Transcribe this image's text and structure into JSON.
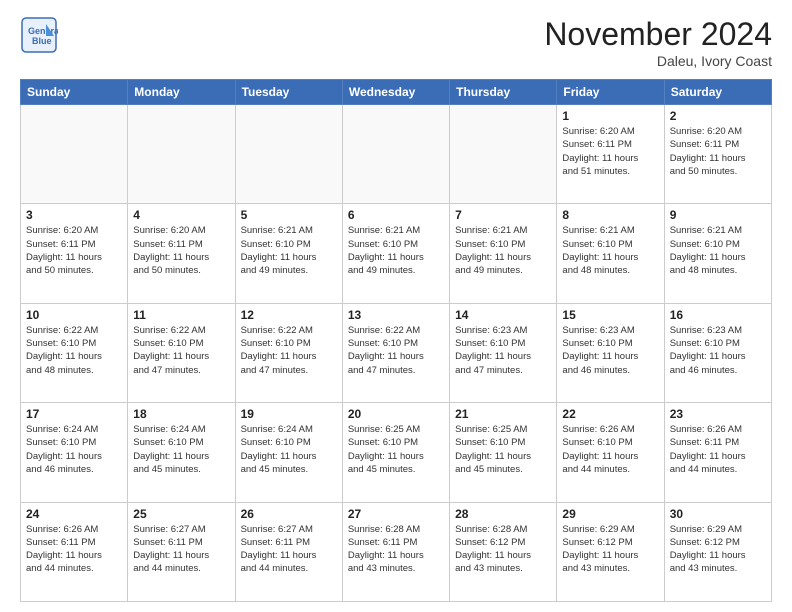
{
  "header": {
    "logo_line1": "General",
    "logo_line2": "Blue",
    "month": "November 2024",
    "location": "Daleu, Ivory Coast"
  },
  "weekdays": [
    "Sunday",
    "Monday",
    "Tuesday",
    "Wednesday",
    "Thursday",
    "Friday",
    "Saturday"
  ],
  "weeks": [
    [
      {
        "day": "",
        "info": ""
      },
      {
        "day": "",
        "info": ""
      },
      {
        "day": "",
        "info": ""
      },
      {
        "day": "",
        "info": ""
      },
      {
        "day": "",
        "info": ""
      },
      {
        "day": "1",
        "info": "Sunrise: 6:20 AM\nSunset: 6:11 PM\nDaylight: 11 hours\nand 51 minutes."
      },
      {
        "day": "2",
        "info": "Sunrise: 6:20 AM\nSunset: 6:11 PM\nDaylight: 11 hours\nand 50 minutes."
      }
    ],
    [
      {
        "day": "3",
        "info": "Sunrise: 6:20 AM\nSunset: 6:11 PM\nDaylight: 11 hours\nand 50 minutes."
      },
      {
        "day": "4",
        "info": "Sunrise: 6:20 AM\nSunset: 6:11 PM\nDaylight: 11 hours\nand 50 minutes."
      },
      {
        "day": "5",
        "info": "Sunrise: 6:21 AM\nSunset: 6:10 PM\nDaylight: 11 hours\nand 49 minutes."
      },
      {
        "day": "6",
        "info": "Sunrise: 6:21 AM\nSunset: 6:10 PM\nDaylight: 11 hours\nand 49 minutes."
      },
      {
        "day": "7",
        "info": "Sunrise: 6:21 AM\nSunset: 6:10 PM\nDaylight: 11 hours\nand 49 minutes."
      },
      {
        "day": "8",
        "info": "Sunrise: 6:21 AM\nSunset: 6:10 PM\nDaylight: 11 hours\nand 48 minutes."
      },
      {
        "day": "9",
        "info": "Sunrise: 6:21 AM\nSunset: 6:10 PM\nDaylight: 11 hours\nand 48 minutes."
      }
    ],
    [
      {
        "day": "10",
        "info": "Sunrise: 6:22 AM\nSunset: 6:10 PM\nDaylight: 11 hours\nand 48 minutes."
      },
      {
        "day": "11",
        "info": "Sunrise: 6:22 AM\nSunset: 6:10 PM\nDaylight: 11 hours\nand 47 minutes."
      },
      {
        "day": "12",
        "info": "Sunrise: 6:22 AM\nSunset: 6:10 PM\nDaylight: 11 hours\nand 47 minutes."
      },
      {
        "day": "13",
        "info": "Sunrise: 6:22 AM\nSunset: 6:10 PM\nDaylight: 11 hours\nand 47 minutes."
      },
      {
        "day": "14",
        "info": "Sunrise: 6:23 AM\nSunset: 6:10 PM\nDaylight: 11 hours\nand 47 minutes."
      },
      {
        "day": "15",
        "info": "Sunrise: 6:23 AM\nSunset: 6:10 PM\nDaylight: 11 hours\nand 46 minutes."
      },
      {
        "day": "16",
        "info": "Sunrise: 6:23 AM\nSunset: 6:10 PM\nDaylight: 11 hours\nand 46 minutes."
      }
    ],
    [
      {
        "day": "17",
        "info": "Sunrise: 6:24 AM\nSunset: 6:10 PM\nDaylight: 11 hours\nand 46 minutes."
      },
      {
        "day": "18",
        "info": "Sunrise: 6:24 AM\nSunset: 6:10 PM\nDaylight: 11 hours\nand 45 minutes."
      },
      {
        "day": "19",
        "info": "Sunrise: 6:24 AM\nSunset: 6:10 PM\nDaylight: 11 hours\nand 45 minutes."
      },
      {
        "day": "20",
        "info": "Sunrise: 6:25 AM\nSunset: 6:10 PM\nDaylight: 11 hours\nand 45 minutes."
      },
      {
        "day": "21",
        "info": "Sunrise: 6:25 AM\nSunset: 6:10 PM\nDaylight: 11 hours\nand 45 minutes."
      },
      {
        "day": "22",
        "info": "Sunrise: 6:26 AM\nSunset: 6:10 PM\nDaylight: 11 hours\nand 44 minutes."
      },
      {
        "day": "23",
        "info": "Sunrise: 6:26 AM\nSunset: 6:11 PM\nDaylight: 11 hours\nand 44 minutes."
      }
    ],
    [
      {
        "day": "24",
        "info": "Sunrise: 6:26 AM\nSunset: 6:11 PM\nDaylight: 11 hours\nand 44 minutes."
      },
      {
        "day": "25",
        "info": "Sunrise: 6:27 AM\nSunset: 6:11 PM\nDaylight: 11 hours\nand 44 minutes."
      },
      {
        "day": "26",
        "info": "Sunrise: 6:27 AM\nSunset: 6:11 PM\nDaylight: 11 hours\nand 44 minutes."
      },
      {
        "day": "27",
        "info": "Sunrise: 6:28 AM\nSunset: 6:11 PM\nDaylight: 11 hours\nand 43 minutes."
      },
      {
        "day": "28",
        "info": "Sunrise: 6:28 AM\nSunset: 6:12 PM\nDaylight: 11 hours\nand 43 minutes."
      },
      {
        "day": "29",
        "info": "Sunrise: 6:29 AM\nSunset: 6:12 PM\nDaylight: 11 hours\nand 43 minutes."
      },
      {
        "day": "30",
        "info": "Sunrise: 6:29 AM\nSunset: 6:12 PM\nDaylight: 11 hours\nand 43 minutes."
      }
    ]
  ]
}
